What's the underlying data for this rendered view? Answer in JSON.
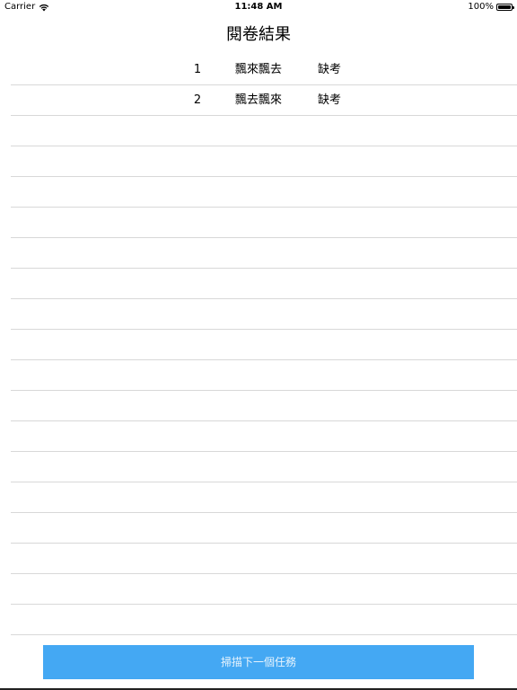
{
  "status_bar": {
    "carrier": "Carrier",
    "time": "11:48 AM",
    "battery": "100%"
  },
  "title": "閱卷結果",
  "rows": [
    {
      "number": "1",
      "name": "飄來飄去",
      "status": "缺考"
    },
    {
      "number": "2",
      "name": "飄去飄來",
      "status": "缺考"
    },
    {
      "number": "",
      "name": "",
      "status": ""
    },
    {
      "number": "",
      "name": "",
      "status": ""
    },
    {
      "number": "",
      "name": "",
      "status": ""
    },
    {
      "number": "",
      "name": "",
      "status": ""
    },
    {
      "number": "",
      "name": "",
      "status": ""
    },
    {
      "number": "",
      "name": "",
      "status": ""
    },
    {
      "number": "",
      "name": "",
      "status": ""
    },
    {
      "number": "",
      "name": "",
      "status": ""
    },
    {
      "number": "",
      "name": "",
      "status": ""
    },
    {
      "number": "",
      "name": "",
      "status": ""
    },
    {
      "number": "",
      "name": "",
      "status": ""
    },
    {
      "number": "",
      "name": "",
      "status": ""
    },
    {
      "number": "",
      "name": "",
      "status": ""
    },
    {
      "number": "",
      "name": "",
      "status": ""
    },
    {
      "number": "",
      "name": "",
      "status": ""
    },
    {
      "number": "",
      "name": "",
      "status": ""
    },
    {
      "number": "",
      "name": "",
      "status": ""
    }
  ],
  "scan_button_label": "掃描下一個任務",
  "colors": {
    "button_bg": "#44a8f3",
    "separator": "#d8d8d8"
  }
}
